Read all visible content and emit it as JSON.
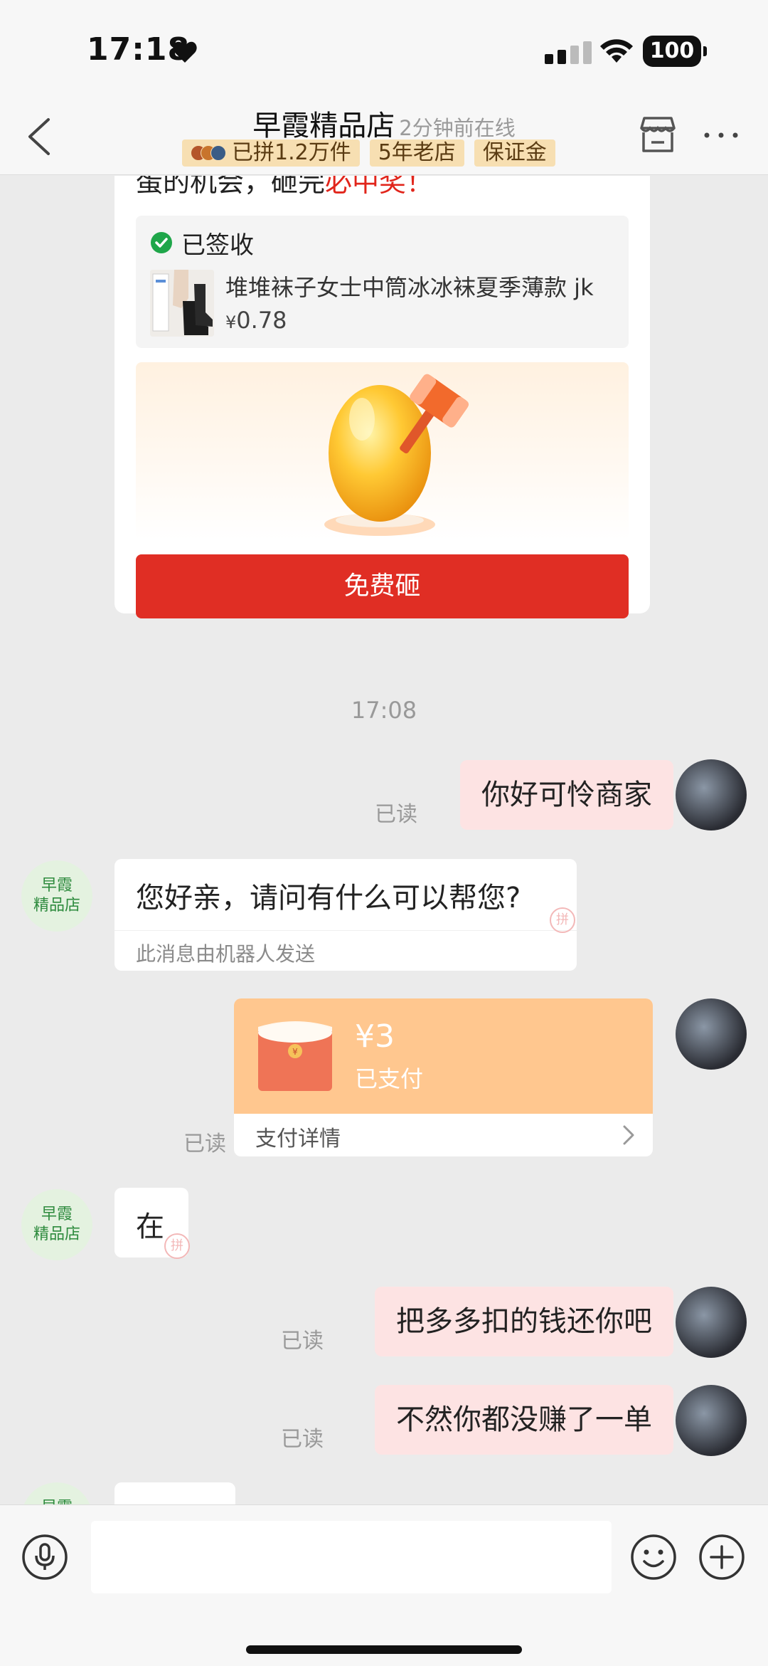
{
  "status_bar": {
    "time": "17:18",
    "battery": "100"
  },
  "header": {
    "shop_name": "早霞精品店",
    "online_status": "2分钟前在线",
    "badges": [
      "已拼1.2万件",
      "5年老店",
      "保证金"
    ]
  },
  "promo_card": {
    "text_prefix": "蛋的机会，砸完",
    "text_highlight": "必中奖！",
    "signed_label": "已签收",
    "product_name": "堆堆袜子女士中筒冰冰袜夏季薄款 jk",
    "price_symbol": "¥",
    "price_value": "0.78",
    "button_label": "免费砸"
  },
  "messages": {
    "timestamp": "17:08",
    "read_label": "已读",
    "shop_avatar_line1": "早霞",
    "shop_avatar_line2": "精品店",
    "out_1": "你好可怜商家",
    "in_1": "您好亲，请问有什么可以帮您?",
    "in_1_note": "此消息由机器人发送",
    "red_packet": {
      "amount": "¥3",
      "status": "已支付",
      "detail": "支付详情"
    },
    "in_2": "在",
    "out_2": "把多多扣的钱还你吧",
    "out_3": "不然你都没赚了一单",
    "pdd_mark": "拼"
  },
  "input_bar": {
    "placeholder": ""
  },
  "colors": {
    "accent_red": "#e02e24",
    "bubble_out": "#fde3e3",
    "red_packet": "#ffc78f"
  }
}
